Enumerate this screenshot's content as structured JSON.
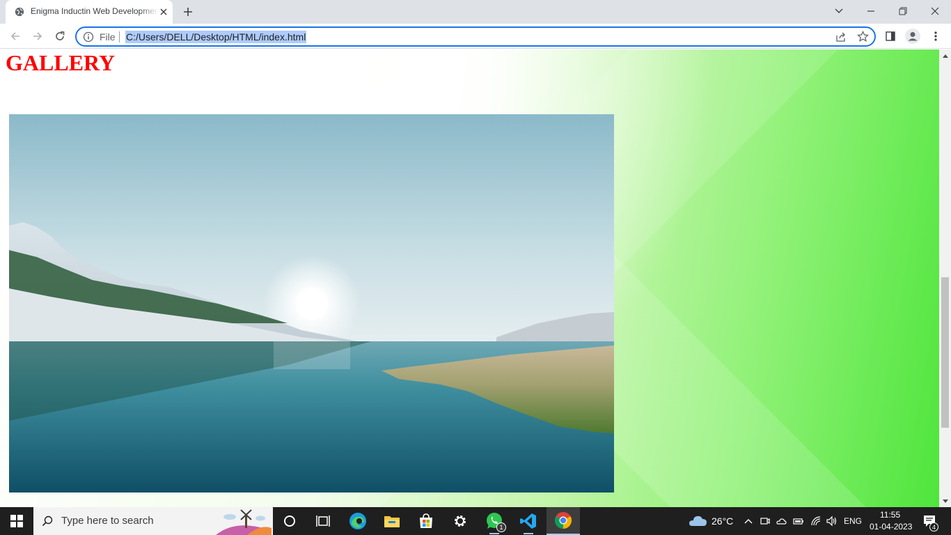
{
  "browser": {
    "tab_title": "Enigma Inductin Web Development",
    "file_label": "File",
    "url": "C:/Users/DELL/Desktop/HTML/index.html"
  },
  "page": {
    "heading": "GALLERY",
    "heading_color": "#ff0000",
    "image_description_icon": "landscape-lake-image"
  },
  "taskbar": {
    "search_placeholder": "Type here to search",
    "whatsapp_badge": "1",
    "weather_temp": "26°C",
    "language": "ENG",
    "time": "11:55",
    "date": "01-04-2023",
    "notification_count": "4"
  },
  "colors": {
    "accent": "#1a73e8",
    "url_highlight": "#aecbfa",
    "taskbar": "#1f1f1f"
  }
}
